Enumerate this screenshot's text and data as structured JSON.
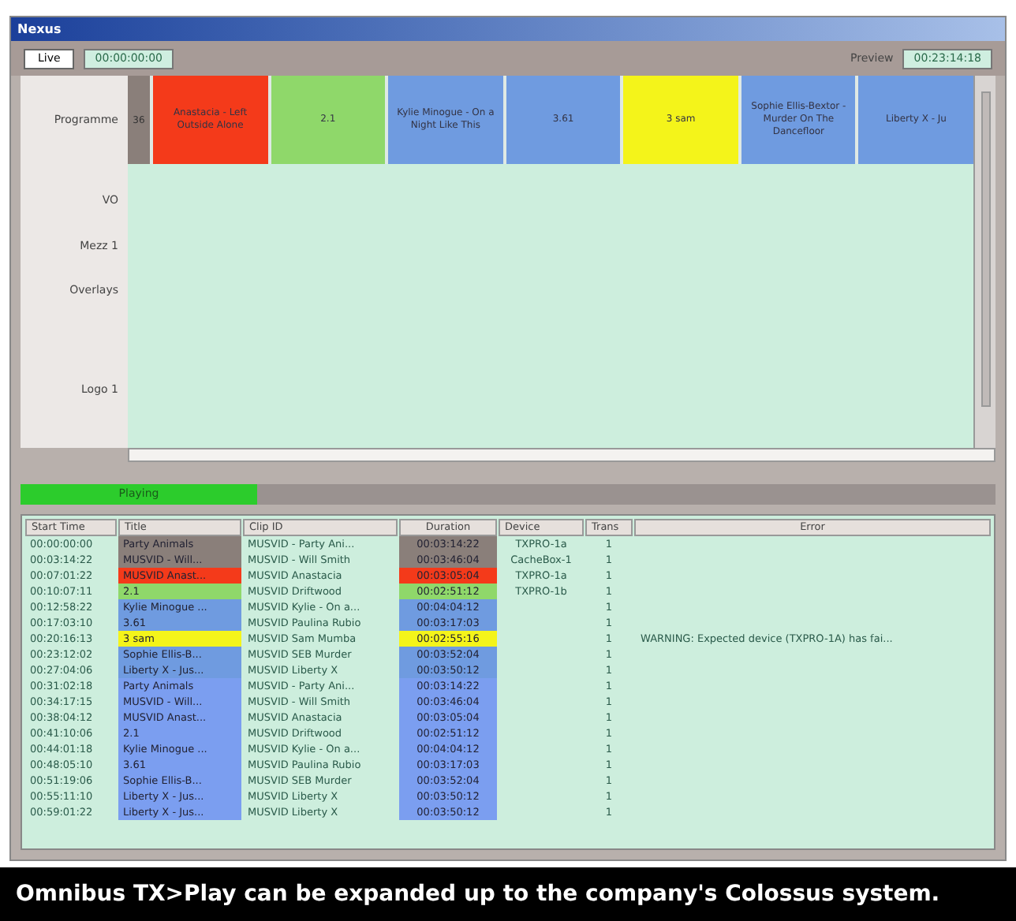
{
  "window": {
    "title": "Nexus"
  },
  "toolbar": {
    "mode_field": "Live",
    "clock": "00:00:00:00",
    "preview_label": "Preview",
    "preview_clock": "00:23:14:18"
  },
  "timeline": {
    "layers": [
      "Programme",
      "VO",
      "Mezz 1",
      "Overlays",
      "Logo 1"
    ],
    "start_marker": "36",
    "blocks": [
      {
        "label": "Anastacia - Left Outside Alone",
        "color": "#f43a1a"
      },
      {
        "label": "2.1",
        "color": "#8fd86a"
      },
      {
        "label": "Kylie Minogue - On a Night Like This",
        "color": "#6f9be0"
      },
      {
        "label": "3.61",
        "color": "#6f9be0"
      },
      {
        "label": "3 sam",
        "color": "#f4f41a"
      },
      {
        "label": "Sophie Ellis-Bextor - Murder On The Dancefloor",
        "color": "#6f9be0"
      },
      {
        "label": "Liberty X - Ju",
        "color": "#6f9be0"
      }
    ]
  },
  "status_bar": {
    "label": "Playing"
  },
  "table": {
    "columns": [
      "Start Time",
      "Title",
      "Clip ID",
      "Duration",
      "Device",
      "Trans",
      "Error"
    ],
    "rows": [
      {
        "start": "00:00:00:00",
        "title": "Party Animals",
        "clip": "MUSVID - Party Ani...",
        "duration": "00:03:14:22",
        "device": "TXPRO-1a",
        "trans": "1",
        "error": "",
        "color": "#8a7f7a"
      },
      {
        "start": "00:03:14:22",
        "title": "MUSVID - Will...",
        "clip": "MUSVID - Will Smith",
        "duration": "00:03:46:04",
        "device": "CacheBox-1",
        "trans": "1",
        "error": "",
        "color": "#8a7f7a"
      },
      {
        "start": "00:07:01:22",
        "title": "MUSVID Anast...",
        "clip": "MUSVID Anastacia",
        "duration": "00:03:05:04",
        "device": "TXPRO-1a",
        "trans": "1",
        "error": "",
        "color": "#f43a1a"
      },
      {
        "start": "00:10:07:11",
        "title": "2.1",
        "clip": "MUSVID Driftwood",
        "duration": "00:02:51:12",
        "device": "TXPRO-1b",
        "trans": "1",
        "error": "",
        "color": "#8fd86a"
      },
      {
        "start": "00:12:58:22",
        "title": "Kylie Minogue ...",
        "clip": "MUSVID Kylie - On a...",
        "duration": "00:04:04:12",
        "device": "",
        "trans": "1",
        "error": "",
        "color": "#6f9be0"
      },
      {
        "start": "00:17:03:10",
        "title": "3.61",
        "clip": "MUSVID Paulina Rubio",
        "duration": "00:03:17:03",
        "device": "",
        "trans": "1",
        "error": "",
        "color": "#6f9be0"
      },
      {
        "start": "00:20:16:13",
        "title": "3 sam",
        "clip": "MUSVID Sam Mumba",
        "duration": "00:02:55:16",
        "device": "",
        "trans": "1",
        "error": "WARNING: Expected device (TXPRO-1A) has fai...",
        "color": "#f4f41a"
      },
      {
        "start": "00:23:12:02",
        "title": "Sophie Ellis-B...",
        "clip": "MUSVID SEB Murder",
        "duration": "00:03:52:04",
        "device": "",
        "trans": "1",
        "error": "",
        "color": "#6f9be0"
      },
      {
        "start": "00:27:04:06",
        "title": "Liberty X - Jus...",
        "clip": "MUSVID Liberty X",
        "duration": "00:03:50:12",
        "device": "",
        "trans": "1",
        "error": "",
        "color": "#6f9be0"
      },
      {
        "start": "00:31:02:18",
        "title": "Party Animals",
        "clip": "MUSVID - Party Ani...",
        "duration": "00:03:14:22",
        "device": "",
        "trans": "1",
        "error": "",
        "color": "#7b9ef0"
      },
      {
        "start": "00:34:17:15",
        "title": "MUSVID - Will...",
        "clip": "MUSVID - Will Smith",
        "duration": "00:03:46:04",
        "device": "",
        "trans": "1",
        "error": "",
        "color": "#7b9ef0"
      },
      {
        "start": "00:38:04:12",
        "title": "MUSVID Anast...",
        "clip": "MUSVID Anastacia",
        "duration": "00:03:05:04",
        "device": "",
        "trans": "1",
        "error": "",
        "color": "#7b9ef0"
      },
      {
        "start": "00:41:10:06",
        "title": "2.1",
        "clip": "MUSVID Driftwood",
        "duration": "00:02:51:12",
        "device": "",
        "trans": "1",
        "error": "",
        "color": "#7b9ef0"
      },
      {
        "start": "00:44:01:18",
        "title": "Kylie Minogue ...",
        "clip": "MUSVID Kylie - On a...",
        "duration": "00:04:04:12",
        "device": "",
        "trans": "1",
        "error": "",
        "color": "#7b9ef0"
      },
      {
        "start": "00:48:05:10",
        "title": "3.61",
        "clip": "MUSVID Paulina Rubio",
        "duration": "00:03:17:03",
        "device": "",
        "trans": "1",
        "error": "",
        "color": "#7b9ef0"
      },
      {
        "start": "00:51:19:06",
        "title": "Sophie Ellis-B...",
        "clip": "MUSVID SEB Murder",
        "duration": "00:03:52:04",
        "device": "",
        "trans": "1",
        "error": "",
        "color": "#7b9ef0"
      },
      {
        "start": "00:55:11:10",
        "title": "Liberty X - Jus...",
        "clip": "MUSVID Liberty X",
        "duration": "00:03:50:12",
        "device": "",
        "trans": "1",
        "error": "",
        "color": "#7b9ef0"
      },
      {
        "start": "00:59:01:22",
        "title": "Liberty X - Jus...",
        "clip": "MUSVID Liberty X",
        "duration": "00:03:50:12",
        "device": "",
        "trans": "1",
        "error": "",
        "color": "#7b9ef0"
      }
    ]
  },
  "caption": "Omnibus TX>Play can be expanded up to the company's Colossus system."
}
